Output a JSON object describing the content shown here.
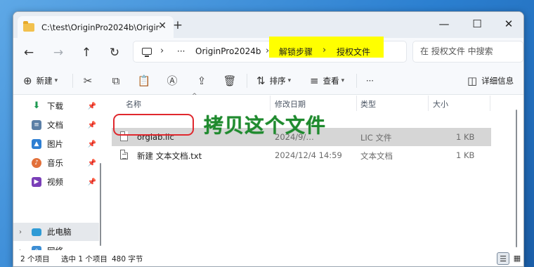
{
  "tab": {
    "title": "C:\\test\\OriginPro2024b\\Origin"
  },
  "address": {
    "crumbs": [
      "OriginPro2024b",
      "解锁步骤",
      "授权文件"
    ],
    "ellipsis": "···",
    "search_placeholder": "在 授权文件 中搜索",
    "highlight_color": "#ffff00"
  },
  "commands": {
    "new_label": "新建",
    "sort_label": "排序",
    "view_label": "查看",
    "more_label": "···",
    "details_label": "详细信息"
  },
  "sidebar": {
    "items": [
      {
        "label": "下载",
        "icon": "download-icon",
        "pinned": true
      },
      {
        "label": "文档",
        "icon": "document-icon",
        "pinned": true
      },
      {
        "label": "图片",
        "icon": "picture-icon",
        "pinned": true
      },
      {
        "label": "音乐",
        "icon": "music-icon",
        "pinned": true
      },
      {
        "label": "视频",
        "icon": "video-icon",
        "pinned": true
      },
      {
        "label": "此电脑",
        "icon": "pc-icon",
        "selected": true
      },
      {
        "label": "网络",
        "icon": "network-icon"
      }
    ]
  },
  "columns": [
    "名称",
    "修改日期",
    "类型",
    "大小"
  ],
  "files": [
    {
      "name": "orglab.lic",
      "modified": "2024/9/…",
      "type": "LIC 文件",
      "size": "1 KB",
      "selected": true
    },
    {
      "name": "新建 文本文档.txt",
      "modified": "2024/12/4 14:59",
      "type": "文本文档",
      "size": "1 KB"
    }
  ],
  "annotation": {
    "text": "拷贝这个文件",
    "color": "#1f8a2e",
    "box_color": "#e0282e"
  },
  "status": {
    "count": "2 个项目",
    "selection": "选中 1 个项目",
    "size": "480 字节"
  }
}
